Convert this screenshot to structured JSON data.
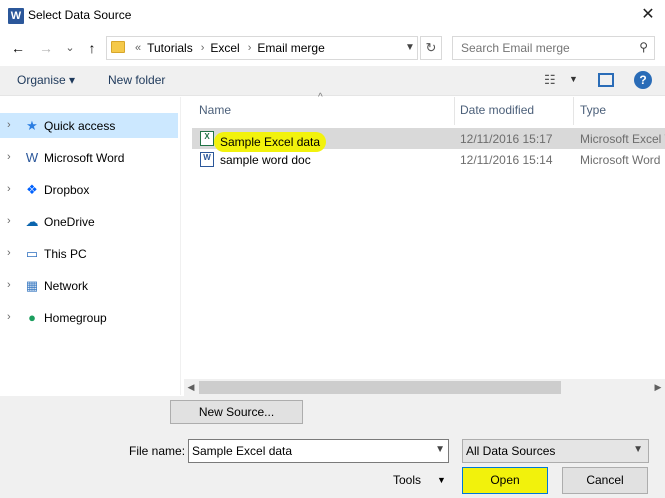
{
  "window": {
    "title": "Select Data Source",
    "app_icon_letter": "W",
    "close_glyph": "✕"
  },
  "nav": {
    "back_glyph": "←",
    "forward_glyph": "→",
    "recent_glyph": "⌄",
    "up_glyph": "↑",
    "breadcrumb_overflow": "«",
    "breadcrumbs": [
      "Tutorials",
      "Excel",
      "Email merge"
    ],
    "refresh_glyph": "↻",
    "search_placeholder": "Search Email merge"
  },
  "commands": {
    "organise": "Organise ▾",
    "new_folder": "New folder",
    "help": "?"
  },
  "sidebar": {
    "items": [
      {
        "label": "Quick access",
        "icon": "star-icon",
        "glyph": "★",
        "color": "#2a7de1",
        "selected": true
      },
      {
        "label": "Microsoft Word",
        "icon": "word-icon",
        "glyph": "W",
        "color": "#2b579a",
        "selected": false
      },
      {
        "label": "Dropbox",
        "icon": "dropbox-icon",
        "glyph": "❖",
        "color": "#0061fe",
        "selected": false
      },
      {
        "label": "OneDrive",
        "icon": "cloud-icon",
        "glyph": "☁",
        "color": "#0a64ad",
        "selected": false
      },
      {
        "label": "This PC",
        "icon": "computer-icon",
        "glyph": "▭",
        "color": "#2f6fbf",
        "selected": false
      },
      {
        "label": "Network",
        "icon": "network-icon",
        "glyph": "▦",
        "color": "#3a7ac2",
        "selected": false
      },
      {
        "label": "Homegroup",
        "icon": "homegroup-icon",
        "glyph": "●",
        "color": "#1b9e5e",
        "selected": false
      }
    ]
  },
  "columns": {
    "name": "Name",
    "date": "Date modified",
    "type": "Type"
  },
  "files": [
    {
      "name": "Sample Excel data",
      "date": "12/11/2016 15:17",
      "type": "Microsoft Excel W",
      "icon": "excel-file-icon",
      "glyph": "X",
      "icon_color": "#217346",
      "selected": true
    },
    {
      "name": "sample word doc",
      "date": "12/11/2016 15:14",
      "type": "Microsoft Word",
      "icon": "word-file-icon",
      "glyph": "W",
      "icon_color": "#2b579a",
      "selected": false
    }
  ],
  "buttons": {
    "new_source": "New Source...",
    "tools": "Tools",
    "open": "Open",
    "cancel": "Cancel"
  },
  "filename": {
    "label": "File name:",
    "value": "Sample Excel data"
  },
  "filter": {
    "value": "All Data Sources"
  },
  "colors": {
    "highlight": "#f2f20c",
    "selection": "#cce8ff",
    "accent": "#0078d7"
  }
}
